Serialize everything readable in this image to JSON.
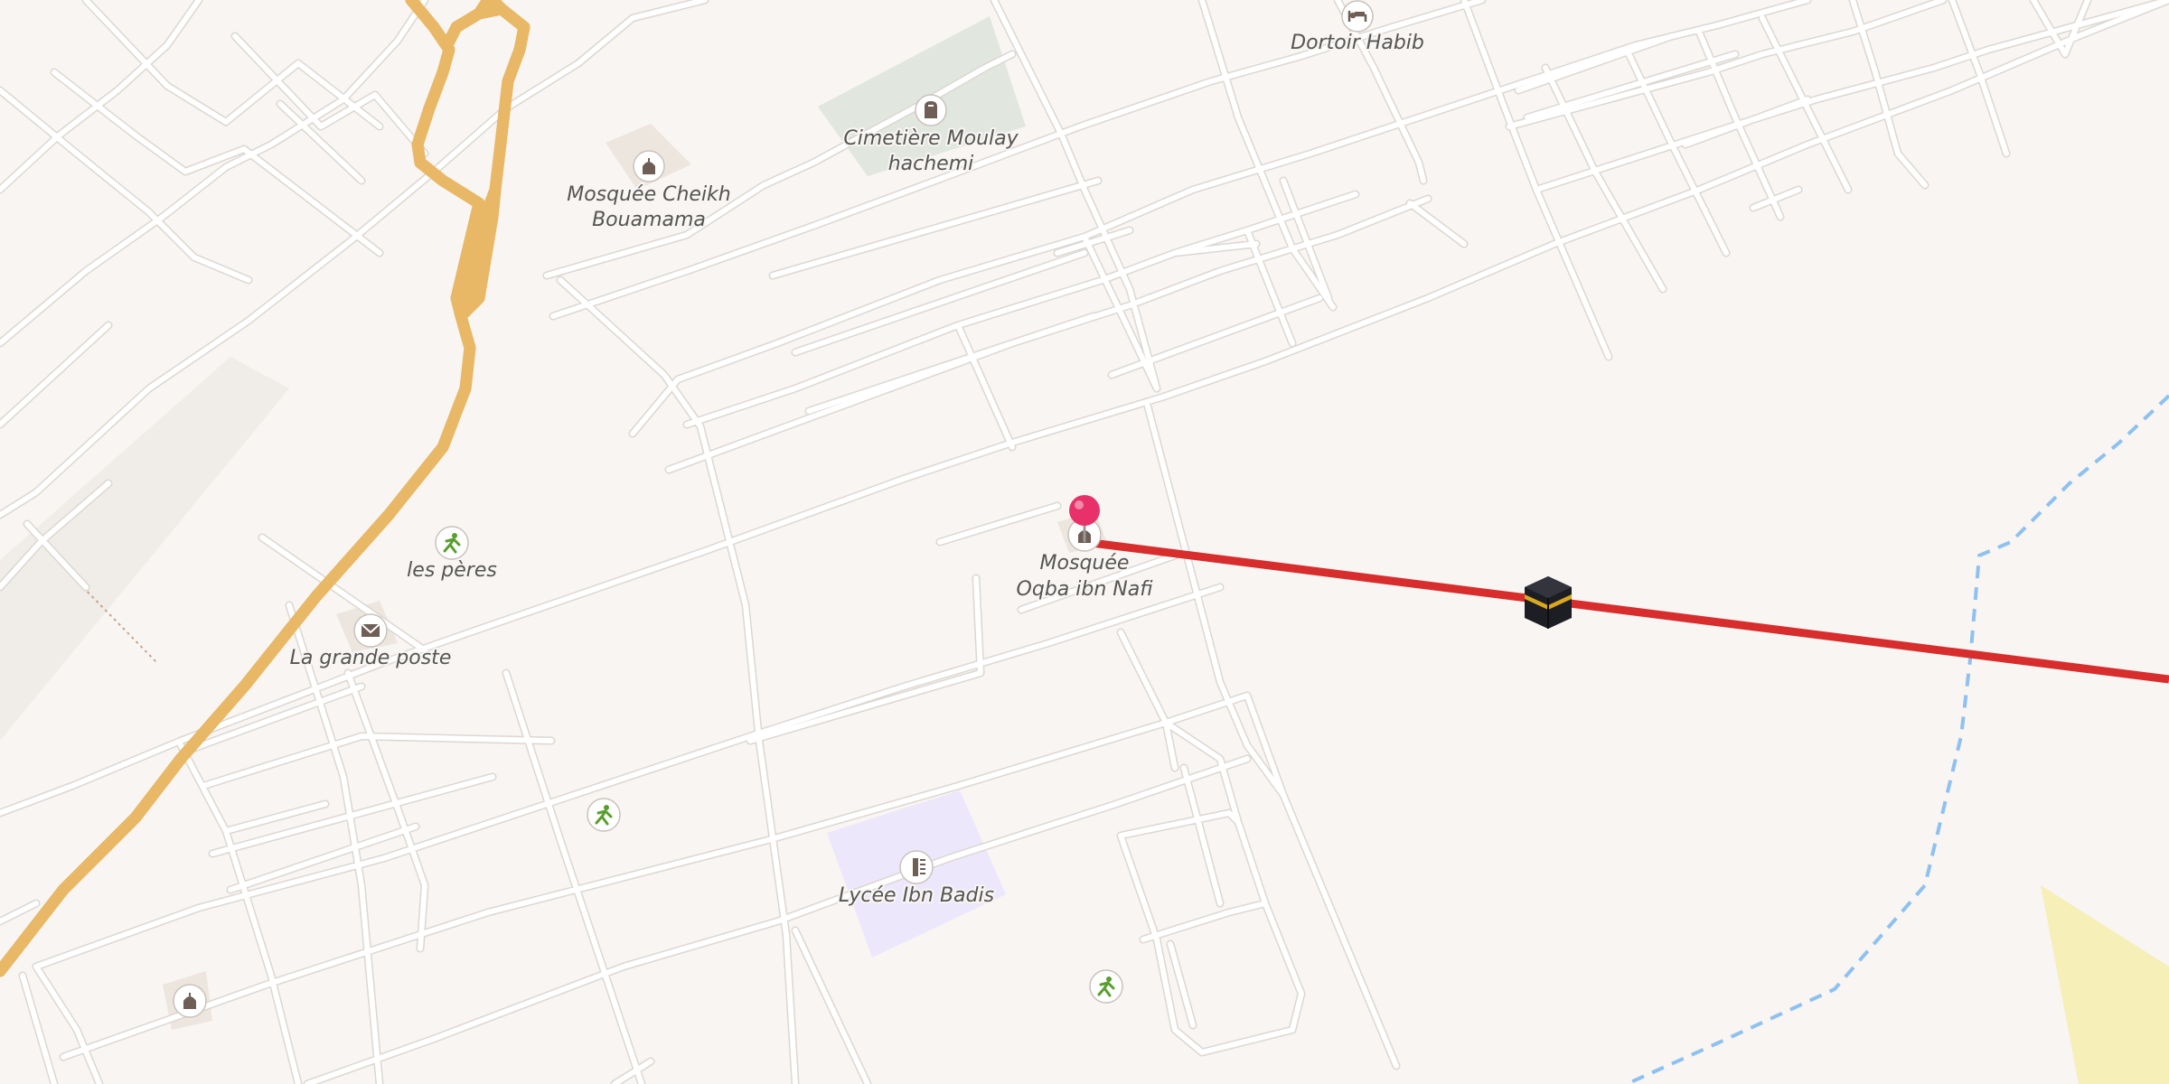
{
  "map": {
    "background": "#f8f5f2",
    "colors": {
      "land": "#f8f5f2",
      "road": "#ffffff",
      "road_casing": "#dcd7d2",
      "primary_road": "#fcdf8d",
      "primary_casing": "#e8b866",
      "cemetery": "#e1e6df",
      "school": "#ede7fb",
      "sand": "#f6efb7",
      "route_line": "#d72d2d",
      "boundary_dashed": "#8ec1f0",
      "pin": "#e8316b",
      "poi_icon": "#6e5e55",
      "sport_icon": "#5a9e2f"
    },
    "labels": {
      "dortoir": "Dortoir Habib",
      "cimetiere_line1": "Cimetière Moulay",
      "cimetiere_line2": "hachemi",
      "mosquee_cheikh_line1": "Mosquée Cheikh",
      "mosquee_cheikh_line2": "Bouamama",
      "les_peres": "les pères",
      "grande_poste": "La grande poste",
      "mosquee_oqba_line1": "Mosquée",
      "mosquee_oqba_line2": "Oqba ibn Nafi",
      "lycee": "Lycée Ibn Badis"
    },
    "icons": {
      "hotel": "bed-icon",
      "cemetery": "gravestone-icon",
      "mosque": "mosque-icon",
      "post": "envelope-icon",
      "sport": "runner-icon",
      "school": "school-icon",
      "pin": "location-pin-icon",
      "qibla_target": "kaaba-icon"
    }
  }
}
